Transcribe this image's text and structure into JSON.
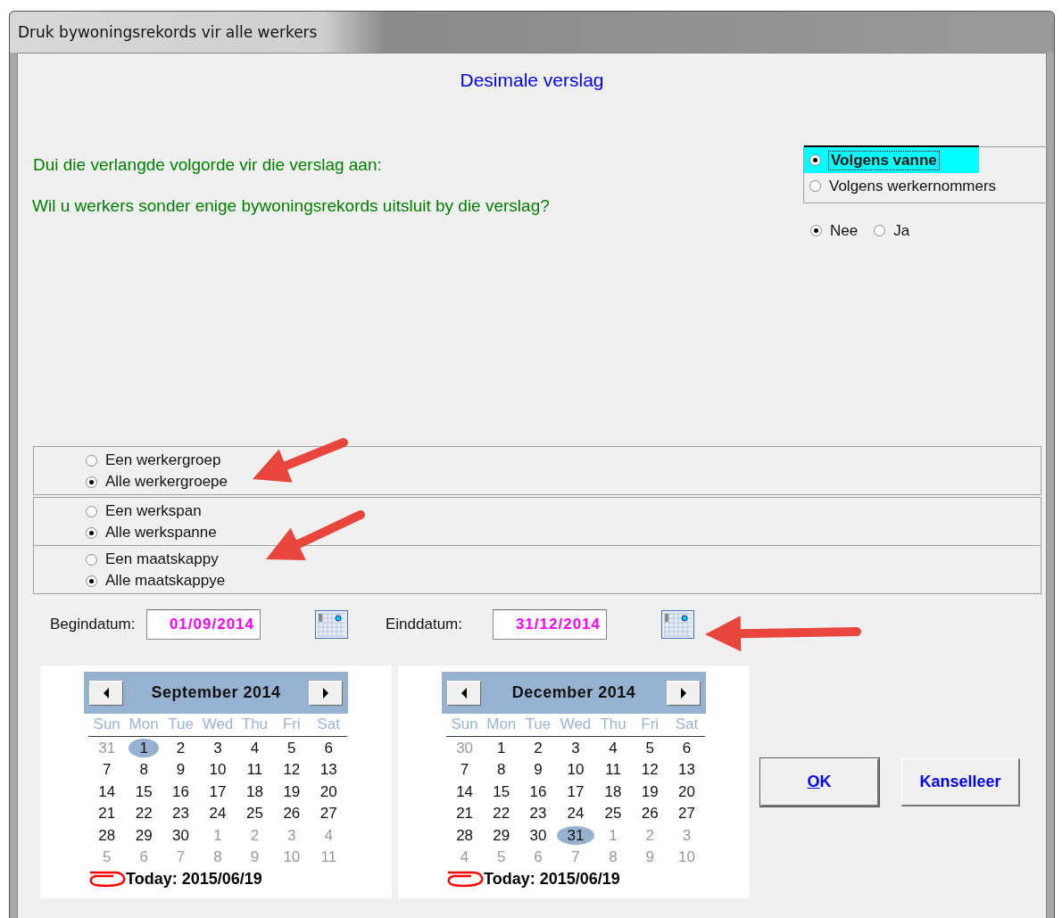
{
  "window": {
    "title": "Druk bywoningsrekords vir alle werkers"
  },
  "heading": "Desimale verslag",
  "questions": [
    "Dui die verlangde volgorde vir die verslag aan:",
    "Wil u werkers sonder enige bywoningsrekords uitsluit by die verslag?"
  ],
  "sort_options": [
    {
      "label": "Volgens vanne",
      "selected": true,
      "focused": true
    },
    {
      "label": "Volgens werkernommers",
      "selected": false,
      "focused": false
    }
  ],
  "exclude_options": [
    {
      "label": "Nee",
      "selected": true
    },
    {
      "label": "Ja",
      "selected": false
    }
  ],
  "filter_groups": [
    {
      "options": [
        {
          "label": "Een werkergroep",
          "selected": false
        },
        {
          "label": "Alle werkergroepe",
          "selected": true
        }
      ]
    },
    {
      "options": [
        {
          "label": "Een werkspan",
          "selected": false
        },
        {
          "label": "Alle werkspanne",
          "selected": true
        }
      ]
    },
    {
      "options": [
        {
          "label": "Een maatskappy",
          "selected": false
        },
        {
          "label": "Alle maatskappye",
          "selected": true
        }
      ]
    }
  ],
  "dates": [
    {
      "label": "Begindatum:",
      "value": "01/09/2014"
    },
    {
      "label": "Einddatum:",
      "value": "31/12/2014"
    }
  ],
  "calendars": [
    {
      "month": "September 2014",
      "weekdays": [
        "Sun",
        "Mon",
        "Tue",
        "Wed",
        "Thu",
        "Fri",
        "Sat"
      ],
      "weeks": [
        [
          {
            "day": "31",
            "other_month": true,
            "selected": false
          },
          {
            "day": "1",
            "other_month": false,
            "selected": true
          },
          {
            "day": "2",
            "other_month": false,
            "selected": false
          },
          {
            "day": "3",
            "other_month": false,
            "selected": false
          },
          {
            "day": "4",
            "other_month": false,
            "selected": false
          },
          {
            "day": "5",
            "other_month": false,
            "selected": false
          },
          {
            "day": "6",
            "other_month": false,
            "selected": false
          }
        ],
        [
          {
            "day": "7",
            "other_month": false,
            "selected": false
          },
          {
            "day": "8",
            "other_month": false,
            "selected": false
          },
          {
            "day": "9",
            "other_month": false,
            "selected": false
          },
          {
            "day": "10",
            "other_month": false,
            "selected": false
          },
          {
            "day": "11",
            "other_month": false,
            "selected": false
          },
          {
            "day": "12",
            "other_month": false,
            "selected": false
          },
          {
            "day": "13",
            "other_month": false,
            "selected": false
          }
        ],
        [
          {
            "day": "14",
            "other_month": false,
            "selected": false
          },
          {
            "day": "15",
            "other_month": false,
            "selected": false
          },
          {
            "day": "16",
            "other_month": false,
            "selected": false
          },
          {
            "day": "17",
            "other_month": false,
            "selected": false
          },
          {
            "day": "18",
            "other_month": false,
            "selected": false
          },
          {
            "day": "19",
            "other_month": false,
            "selected": false
          },
          {
            "day": "20",
            "other_month": false,
            "selected": false
          }
        ],
        [
          {
            "day": "21",
            "other_month": false,
            "selected": false
          },
          {
            "day": "22",
            "other_month": false,
            "selected": false
          },
          {
            "day": "23",
            "other_month": false,
            "selected": false
          },
          {
            "day": "24",
            "other_month": false,
            "selected": false
          },
          {
            "day": "25",
            "other_month": false,
            "selected": false
          },
          {
            "day": "26",
            "other_month": false,
            "selected": false
          },
          {
            "day": "27",
            "other_month": false,
            "selected": false
          }
        ],
        [
          {
            "day": "28",
            "other_month": false,
            "selected": false
          },
          {
            "day": "29",
            "other_month": false,
            "selected": false
          },
          {
            "day": "30",
            "other_month": false,
            "selected": false
          },
          {
            "day": "1",
            "other_month": true,
            "selected": false
          },
          {
            "day": "2",
            "other_month": true,
            "selected": false
          },
          {
            "day": "3",
            "other_month": true,
            "selected": false
          },
          {
            "day": "4",
            "other_month": true,
            "selected": false
          }
        ],
        [
          {
            "day": "5",
            "other_month": true,
            "selected": false
          },
          {
            "day": "6",
            "other_month": true,
            "selected": false
          },
          {
            "day": "7",
            "other_month": true,
            "selected": false
          },
          {
            "day": "8",
            "other_month": true,
            "selected": false
          },
          {
            "day": "9",
            "other_month": true,
            "selected": false
          },
          {
            "day": "10",
            "other_month": true,
            "selected": false
          },
          {
            "day": "11",
            "other_month": true,
            "selected": false
          }
        ]
      ],
      "today": "Today: 2015/06/19"
    },
    {
      "month": "December 2014",
      "weekdays": [
        "Sun",
        "Mon",
        "Tue",
        "Wed",
        "Thu",
        "Fri",
        "Sat"
      ],
      "weeks": [
        [
          {
            "day": "30",
            "other_month": true,
            "selected": false
          },
          {
            "day": "1",
            "other_month": false,
            "selected": false
          },
          {
            "day": "2",
            "other_month": false,
            "selected": false
          },
          {
            "day": "3",
            "other_month": false,
            "selected": false
          },
          {
            "day": "4",
            "other_month": false,
            "selected": false
          },
          {
            "day": "5",
            "other_month": false,
            "selected": false
          },
          {
            "day": "6",
            "other_month": false,
            "selected": false
          }
        ],
        [
          {
            "day": "7",
            "other_month": false,
            "selected": false
          },
          {
            "day": "8",
            "other_month": false,
            "selected": false
          },
          {
            "day": "9",
            "other_month": false,
            "selected": false
          },
          {
            "day": "10",
            "other_month": false,
            "selected": false
          },
          {
            "day": "11",
            "other_month": false,
            "selected": false
          },
          {
            "day": "12",
            "other_month": false,
            "selected": false
          },
          {
            "day": "13",
            "other_month": false,
            "selected": false
          }
        ],
        [
          {
            "day": "14",
            "other_month": false,
            "selected": false
          },
          {
            "day": "15",
            "other_month": false,
            "selected": false
          },
          {
            "day": "16",
            "other_month": false,
            "selected": false
          },
          {
            "day": "17",
            "other_month": false,
            "selected": false
          },
          {
            "day": "18",
            "other_month": false,
            "selected": false
          },
          {
            "day": "19",
            "other_month": false,
            "selected": false
          },
          {
            "day": "20",
            "other_month": false,
            "selected": false
          }
        ],
        [
          {
            "day": "21",
            "other_month": false,
            "selected": false
          },
          {
            "day": "22",
            "other_month": false,
            "selected": false
          },
          {
            "day": "23",
            "other_month": false,
            "selected": false
          },
          {
            "day": "24",
            "other_month": false,
            "selected": false
          },
          {
            "day": "25",
            "other_month": false,
            "selected": false
          },
          {
            "day": "26",
            "other_month": false,
            "selected": false
          },
          {
            "day": "27",
            "other_month": false,
            "selected": false
          }
        ],
        [
          {
            "day": "28",
            "other_month": false,
            "selected": false
          },
          {
            "day": "29",
            "other_month": false,
            "selected": false
          },
          {
            "day": "30",
            "other_month": false,
            "selected": false
          },
          {
            "day": "31",
            "other_month": false,
            "selected": true
          },
          {
            "day": "1",
            "other_month": true,
            "selected": false
          },
          {
            "day": "2",
            "other_month": true,
            "selected": false
          },
          {
            "day": "3",
            "other_month": true,
            "selected": false
          }
        ],
        [
          {
            "day": "4",
            "other_month": true,
            "selected": false
          },
          {
            "day": "5",
            "other_month": true,
            "selected": false
          },
          {
            "day": "6",
            "other_month": true,
            "selected": false
          },
          {
            "day": "7",
            "other_month": true,
            "selected": false
          },
          {
            "day": "8",
            "other_month": true,
            "selected": false
          },
          {
            "day": "9",
            "other_month": true,
            "selected": false
          },
          {
            "day": "10",
            "other_month": true,
            "selected": false
          }
        ]
      ],
      "today": "Today: 2015/06/19"
    }
  ],
  "buttons": [
    {
      "label": "OK",
      "mnemonic": true,
      "default": true
    },
    {
      "label": "Kanselleer",
      "mnemonic": false,
      "default": false
    }
  ]
}
